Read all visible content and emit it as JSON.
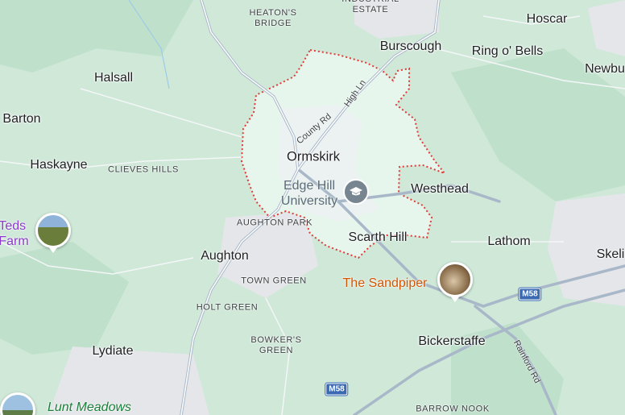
{
  "map": {
    "boundary_area": "Ormskirk",
    "colors": {
      "land": "#cfe8d8",
      "boundary_fill": "#e6f6ec",
      "boundary_stroke": "#e53935",
      "major_road": "#a9b8c9",
      "motorway_shield": "#3b6ab3",
      "urban": "#e4e6e9"
    },
    "labels": {
      "heatons_bridge": "HEATON'S\nBRIDGE",
      "industrial_estate": "INDUSTRIAL\nESTATE",
      "burscough": "Burscough",
      "hoscar": "Hoscar",
      "ring_o_bells": "Ring o' Bells",
      "newburgh": "Newbu",
      "halsall": "Halsall",
      "barton": "Barton",
      "haskayne": "Haskayne",
      "clieves_hills": "CLIEVES HILLS",
      "ormskirk": "Ormskirk",
      "edge_hill": "Edge Hill\nUniversity",
      "westhead": "Westhead",
      "aughton_park": "AUGHTON PARK",
      "scarth_hill": "Scarth Hill",
      "lathom": "Lathom",
      "skelmersdale": "Skeli",
      "aughton": "Aughton",
      "town_green": "TOWN GREEN",
      "the_sandpiper": "The Sandpiper",
      "holt_green": "HOLT GREEN",
      "bowkers_green": "BOWKER'S\nGREEN",
      "lydiate": "Lydiate",
      "bickerstaffe": "Bickerstaffe",
      "lunt_meadows": "Lunt Meadows",
      "barrow_nook": "BARROW NOOK",
      "teds_farm": "Teds\nFarm"
    },
    "roads": {
      "county_rd": "County Rd",
      "high_ln": "High Ln",
      "rainford_rd": "Rainford Rd",
      "m58_a": "M58",
      "m58_b": "M58"
    },
    "icons": {
      "university": "graduation-cap-icon",
      "sandpiper_photo": "pub-photo-icon",
      "teds_farm_photo": "farm-photo-icon",
      "lunt_meadows_photo": "nature-photo-icon"
    }
  }
}
